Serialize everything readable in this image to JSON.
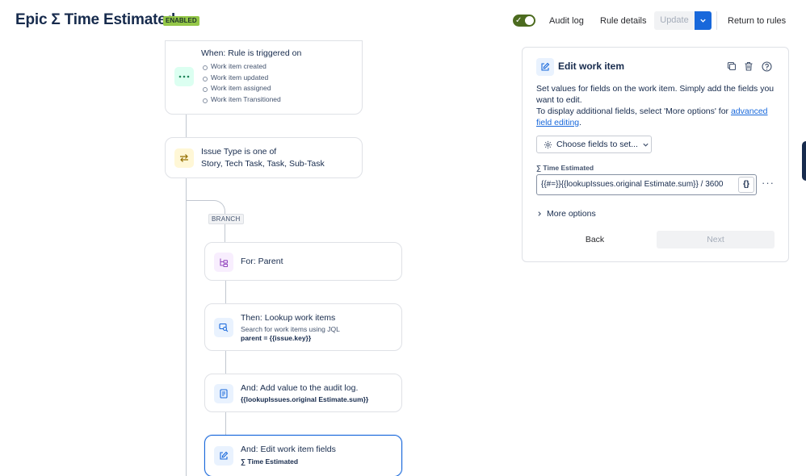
{
  "header": {
    "title": "Epic Σ Time Estimated",
    "status": "ENABLED",
    "audit_log": "Audit log",
    "rule_details": "Rule details",
    "update": "Update",
    "return_to_rules": "Return to rules"
  },
  "flow": {
    "trigger": {
      "title": "When: Rule is triggered on",
      "items": [
        "Work item created",
        "Work item updated",
        "Work item assigned",
        "Work item Transitioned"
      ],
      "icon": "ellipsis-icon"
    },
    "condition": {
      "title": "Issue Type is one of",
      "value": "Story, Tech Task, Task, Sub-Task",
      "icon": "swap-arrows-icon"
    },
    "branch_label": "BRANCH",
    "for_parent": {
      "title": "For: Parent",
      "icon": "hierarchy-icon"
    },
    "lookup": {
      "title": "Then: Lookup work items",
      "subtitle": "Search for work items using JQL",
      "jql": "parent = {{issue.key}}",
      "icon": "search-items-icon"
    },
    "audit": {
      "title": "And: Add value to the audit log.",
      "value": "{{lookupIssues.original Estimate.sum}}",
      "icon": "document-icon"
    },
    "edit": {
      "title": "And: Edit work item fields",
      "value": "∑ Time Estimated",
      "icon": "edit-icon"
    }
  },
  "panel": {
    "title": "Edit work item",
    "desc_line1": "Set values for fields on the work item. Simply add the fields you want to edit.",
    "desc_line2": "To display additional fields, select 'More options' for ",
    "desc_link": "advanced field editing",
    "desc_end": ".",
    "choose_fields": "Choose fields to set...",
    "field_label": "∑ Time Estimated",
    "field_value": "{{#=}}{{lookupIssues.original Estimate.sum}} / 3600",
    "smart_value_btn": "{}",
    "more_options": "More options",
    "back": "Back",
    "next": "Next"
  },
  "colors": {
    "accent": "#1868db",
    "enabled_badge": "#94c748",
    "toggle_on": "#4c6b1f"
  }
}
